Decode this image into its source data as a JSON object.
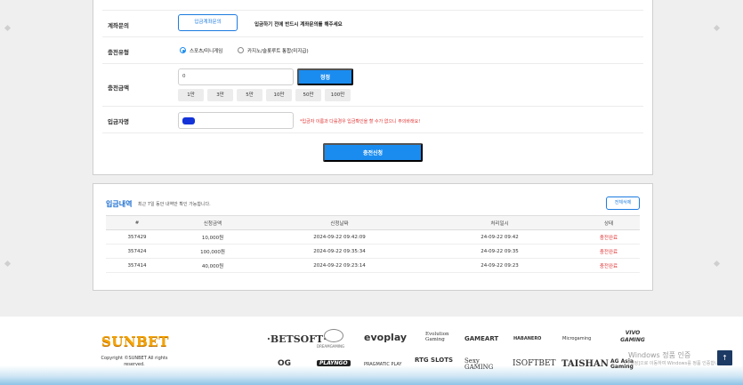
{
  "form": {
    "account_inquiry": {
      "label": "계좌문의",
      "button": "입금계좌문의",
      "note": "입금하기 전에 반드시 계좌문의를 해주세요"
    },
    "charge_type": {
      "label": "충전유형",
      "options": [
        "스포츠/미니게임",
        "카지노/슬롯루트 통합(미지급)"
      ],
      "selected": 0
    },
    "charge_amount": {
      "label": "충전금액",
      "value": "0",
      "reset_button": "정정",
      "quick_amounts": [
        "1만",
        "3만",
        "5만",
        "10만",
        "50만",
        "100만"
      ]
    },
    "depositor": {
      "label": "입금자명",
      "note": "*입금자 이름과 다를경우 입금확인을 할 수가 없으니 주의바래요!"
    },
    "submit_button": "충전신청"
  },
  "history": {
    "title": "입금내역",
    "subtitle": "최근 7일 동안 내역만 확인 가능합니다.",
    "delete_button": "전체삭제",
    "columns": [
      "#",
      "신청금액",
      "신청날짜",
      "처리일시",
      "상태"
    ],
    "rows": [
      [
        "357429",
        "10,000원",
        "2024-09-22 09:42:09",
        "24-09-22 09:42",
        "충전완료"
      ],
      [
        "357424",
        "100,000원",
        "2024-09-22 09:35:34",
        "24-09-22 09:35",
        "충전완료"
      ],
      [
        "357414",
        "40,000원",
        "2024-09-22 09:23:14",
        "24-09-22 09:23",
        "충전완료"
      ]
    ]
  },
  "footer": {
    "brand": "SUNBET",
    "copyright": "Copyright ©SUNBET All rights reserved.",
    "partners_row1": [
      "·BETSOFT·",
      "DREAMGAMING",
      "evoplay",
      "Evolution Gaming",
      "GAMEART",
      "HABANERO",
      "Microgaming",
      "VIVO GAMING"
    ],
    "partners_row2": [
      "OG",
      "PLAYNGO",
      "PRAGMATIC PLAY",
      "RTG SLOTS",
      "Sexy GAMING",
      "ISOFTBET",
      "TAISHAN",
      "AG Asia Gaming"
    ],
    "windows_activation": "Windows 정품 인증",
    "windows_activation_sub": "[설정]으로 이동하여 Windows를 정품 인증합니다.",
    "scroll_top": "↑"
  },
  "colors": {
    "accent": "#1a8cf0",
    "status_done": "#e03030",
    "background": "#efeff0"
  }
}
